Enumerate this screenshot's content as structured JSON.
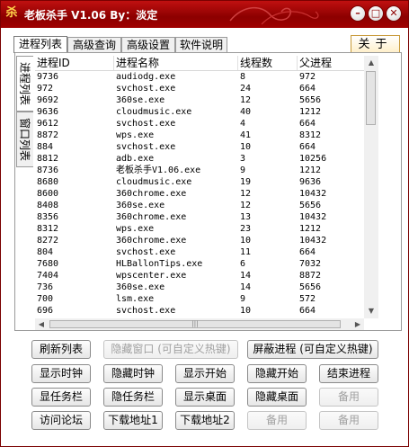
{
  "window": {
    "title": "老板杀手 V1.06 By：淡定",
    "app_icon": "杀",
    "min_glyph": "–",
    "max_glyph": "□",
    "close_glyph": "✕"
  },
  "tabs": [
    "进程列表",
    "高级查询",
    "高级设置",
    "软件说明"
  ],
  "about_label": "关于",
  "side_tabs": [
    "进程列表",
    "窗口列表"
  ],
  "columns": [
    "进程ID",
    "进程名称",
    "线程数",
    "父进程"
  ],
  "rows": [
    [
      "9736",
      "audiodg.exe",
      "8",
      "972"
    ],
    [
      "972",
      "svchost.exe",
      "24",
      "664"
    ],
    [
      "9692",
      "360se.exe",
      "12",
      "5656"
    ],
    [
      "9636",
      "cloudmusic.exe",
      "40",
      "1212"
    ],
    [
      "9612",
      "svchost.exe",
      "4",
      "664"
    ],
    [
      "8872",
      "wps.exe",
      "41",
      "8312"
    ],
    [
      "884",
      "svchost.exe",
      "10",
      "664"
    ],
    [
      "8812",
      "adb.exe",
      "3",
      "10256"
    ],
    [
      "8736",
      "老板杀手V1.06.exe",
      "9",
      "1212"
    ],
    [
      "8680",
      "cloudmusic.exe",
      "19",
      "9636"
    ],
    [
      "8600",
      "360chrome.exe",
      "12",
      "10432"
    ],
    [
      "8408",
      "360se.exe",
      "12",
      "5656"
    ],
    [
      "8356",
      "360chrome.exe",
      "13",
      "10432"
    ],
    [
      "8312",
      "wps.exe",
      "23",
      "1212"
    ],
    [
      "8272",
      "360chrome.exe",
      "10",
      "10432"
    ],
    [
      "804",
      "svchost.exe",
      "11",
      "664"
    ],
    [
      "7680",
      "HLBallonTips.exe",
      "6",
      "7032"
    ],
    [
      "7404",
      "wpscenter.exe",
      "14",
      "8872"
    ],
    [
      "736",
      "360se.exe",
      "14",
      "5656"
    ],
    [
      "700",
      "lsm.exe",
      "9",
      "572"
    ],
    [
      "696",
      "svchost.exe",
      "10",
      "664"
    ]
  ],
  "buttons": {
    "refresh": "刷新列表",
    "hide_window": "隐藏窗口 (可自定义热键)",
    "block_process": "屏蔽进程 (可自定义热键)",
    "show_clock": "显示时钟",
    "hide_clock": "隐藏时钟",
    "show_start": "显示开始",
    "hide_start": "隐藏开始",
    "end_process": "结束进程",
    "show_taskbar": "显任务栏",
    "hide_taskbar": "隐任务栏",
    "show_desktop": "显示桌面",
    "hide_desktop": "隐藏桌面",
    "reserved_1": "备用",
    "forum": "访问论坛",
    "download_1": "下载地址1",
    "download_2": "下载地址2",
    "reserved_2": "备用",
    "reserved_3": "备用"
  },
  "colors": {
    "title_bar": "#a00000",
    "accent": "#ffd24a"
  }
}
